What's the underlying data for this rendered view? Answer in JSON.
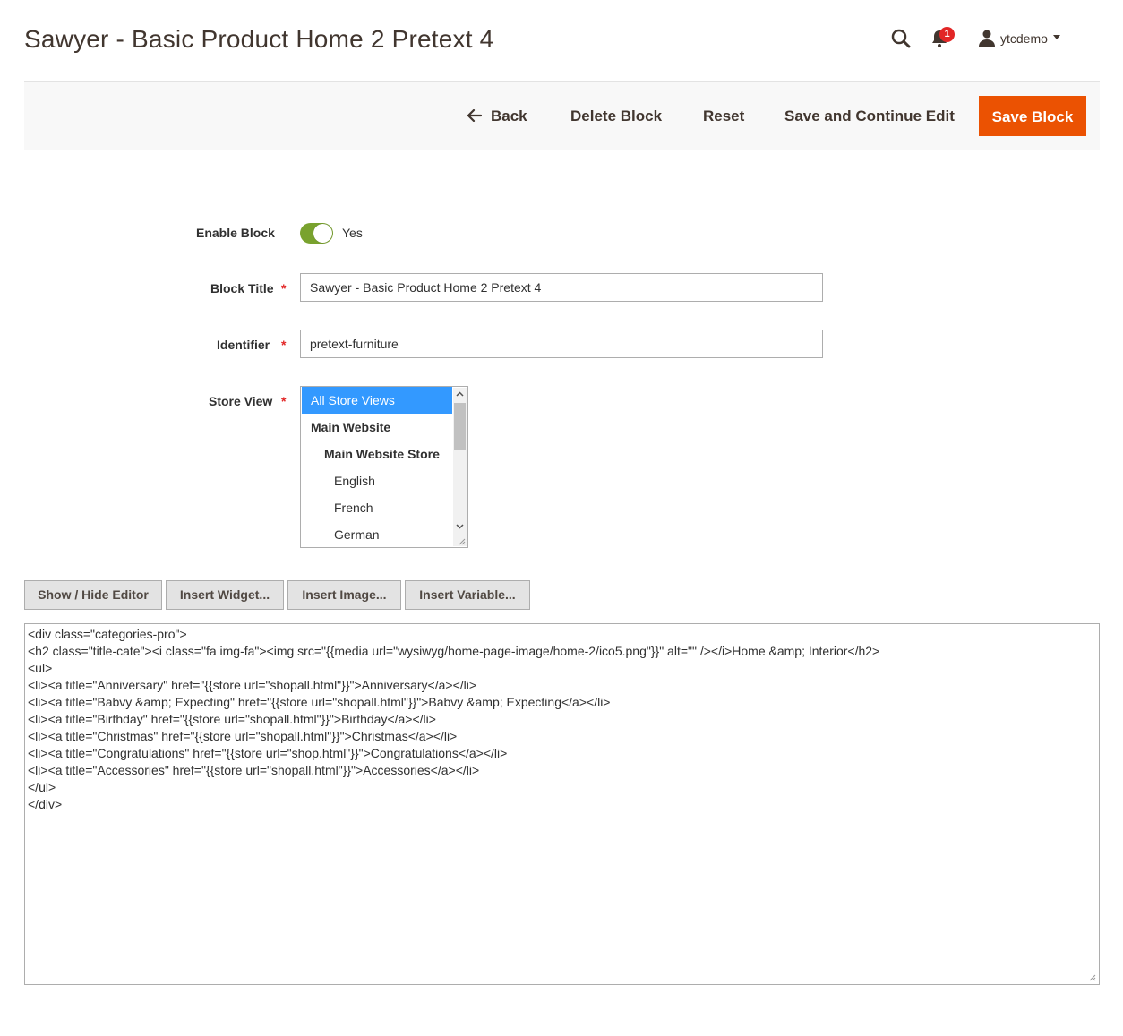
{
  "header": {
    "title": "Sawyer - Basic Product Home 2 Pretext 4",
    "notification_count": "1",
    "username": "ytcdemo"
  },
  "actions": {
    "back": "Back",
    "delete": "Delete Block",
    "reset": "Reset",
    "save_continue": "Save and Continue Edit",
    "save": "Save Block"
  },
  "form": {
    "enable_label": "Enable Block",
    "enable_value": "Yes",
    "title_label": "Block Title",
    "title_value": "Sawyer - Basic Product Home 2 Pretext 4",
    "identifier_label": "Identifier",
    "identifier_value": "pretext-furniture",
    "store_view_label": "Store View",
    "required_mark": "*",
    "store_view_options": [
      {
        "label": "All Store Views",
        "selected": true
      },
      {
        "label": "Main Website"
      },
      {
        "label": "Main Website Store"
      },
      {
        "label": "English"
      },
      {
        "label": "French"
      },
      {
        "label": "German"
      }
    ]
  },
  "editor": {
    "show_hide": "Show / Hide Editor",
    "insert_widget": "Insert Widget...",
    "insert_image": "Insert Image...",
    "insert_variable": "Insert Variable...",
    "content_lines": [
      "<div class=\"categories-pro\">",
      "<h2 class=\"title-cate\"><i class=\"fa img-fa\"><img src=\"{{media url=\"wysiwyg/home-page-image/home-2/ico5.png\"}}\" alt=\"\" /></i>Home &amp; Interior</h2>",
      "<ul>",
      "<li><a title=\"Anniversary\" href=\"{{store url=\"shopall.html\"}}\">Anniversary</a></li>",
      "<li><a title=\"Babvy &amp; Expecting\" href=\"{{store url=\"shopall.html\"}}\">Babvy &amp; Expecting</a></li>",
      "<li><a title=\"Birthday\" href=\"{{store url=\"shopall.html\"}}\">Birthday</a></li>",
      "<li><a title=\"Christmas\" href=\"{{store url=\"shopall.html\"}}\">Christmas</a></li>",
      "<li><a title=\"Congratulations\" href=\"{{store url=\"shop.html\"}}\">Congratulations</a></li>",
      "<li><a title=\"Accessories\" href=\"{{store url=\"shopall.html\"}}\">Accessories</a></li>",
      "</ul>",
      "</div>"
    ]
  },
  "colors": {
    "primary_action": "#eb5202",
    "toggle_on": "#79a22e",
    "selected_option": "#3399ff",
    "badge": "#e22626"
  }
}
